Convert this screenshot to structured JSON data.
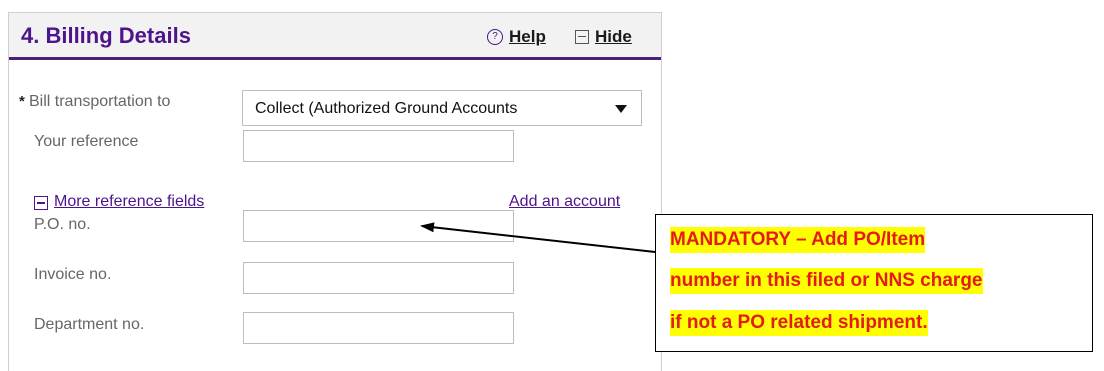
{
  "header": {
    "title": "4. Billing Details",
    "help_label": "Help",
    "help_icon": "?",
    "hide_label": "Hide"
  },
  "form": {
    "required_mark": "*",
    "bill_to_label": "Bill transportation to",
    "bill_to_value": "Collect (Authorized Ground Accounts",
    "your_reference_label": "Your reference",
    "your_reference_value": "",
    "more_reference_label": "More reference fields",
    "add_account_label": "Add an account",
    "po_label": "P.O. no.",
    "po_value": "",
    "invoice_label": "Invoice no.",
    "invoice_value": "",
    "department_label": "Department no.",
    "department_value": ""
  },
  "callout": {
    "lines": [
      "MANDATORY – Add PO/Item",
      "number in this filed or NNS charge",
      "if not a PO related shipment."
    ],
    "text_color": "#e31b1b",
    "highlight_color": "#ffff00"
  },
  "colors": {
    "brand_purple": "#4d148c",
    "header_bg": "#f2f2f2"
  }
}
